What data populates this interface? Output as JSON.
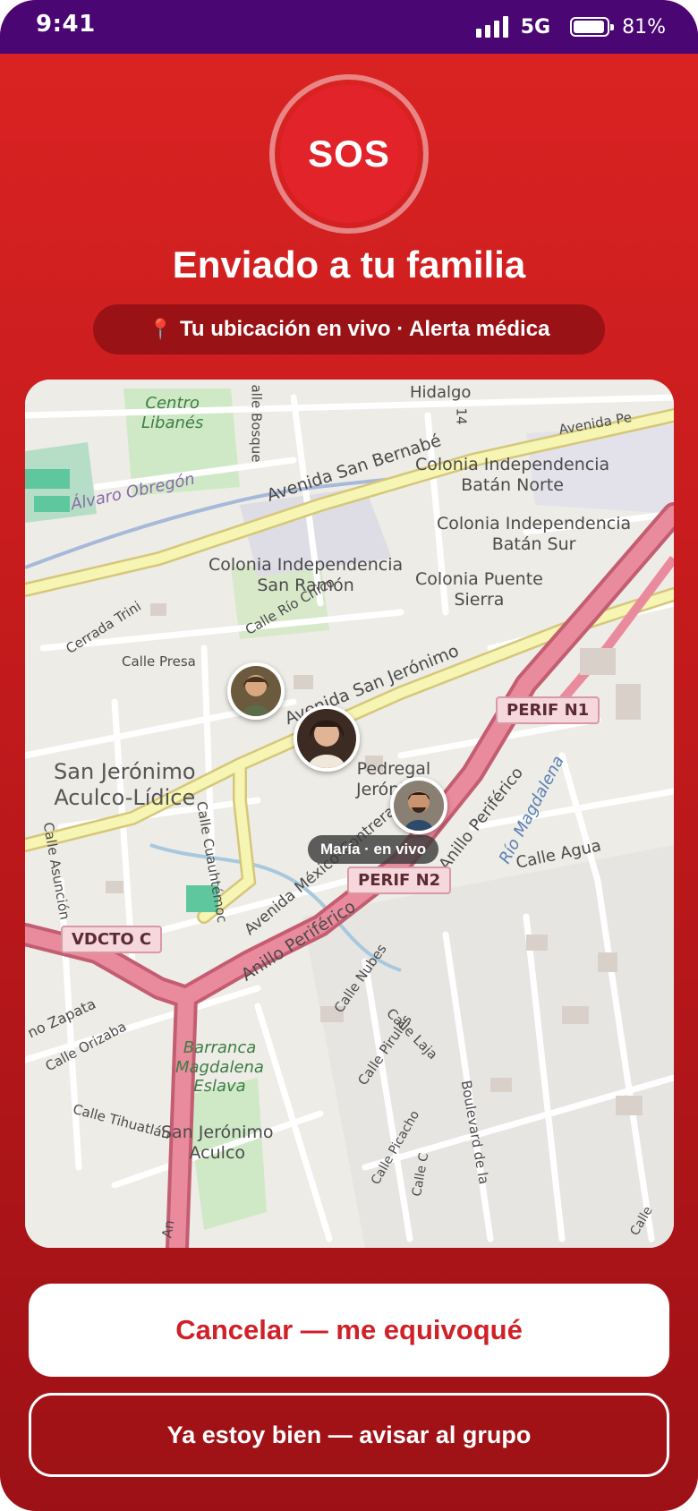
{
  "status_bar": {
    "time": "9:41",
    "network": "5G",
    "battery": "81%",
    "signal_icon": "signal-bars-icon",
    "battery_icon": "battery-icon"
  },
  "header": {
    "sos_label": "SOS",
    "title": "Enviado a tu familia",
    "pin_icon": "📍",
    "subtitle": "Tu ubicación en vivo · Alerta médica"
  },
  "map": {
    "labels": {
      "hidalgo": "Hidalgo",
      "centro_libanes": "Centro\nLibanés",
      "bosque": "alle Bosque",
      "alvaro_obregon": "Álvaro Obregón",
      "av_pe": "Avenida Pe",
      "col_batan_norte": "Colonia Independencia\nBatán Norte",
      "col_batan_sur": "Colonia Independencia\nBatán Sur",
      "col_san_ramon": "Colonia Independencia\nSan Ramón",
      "col_puente_sierra": "Colonia Puente\nSierra",
      "av_san_bernabe": "Avenida San Bernabé",
      "calle_rio_chico": "Calle Río Chico",
      "cerrada_trini": "Cerrada Trini",
      "calle_presa": "Calle Presa",
      "av_san_jeronimo": "Avenida San Jerónimo",
      "san_jeronimo_aculco_lidice": "San Jerónimo\nAculco-Lídice",
      "pedregal": "Pedregal\nJerónimo",
      "calle_cuauhtemoc": "Calle Cuauhtémoc",
      "calle_asuncion": "Calle Asunción",
      "av_mexico_contreras": "Avenida México-Contreras",
      "anillo_periferico_1": "Anillo Periférico",
      "anillo_periferico_2": "Anillo Periférico",
      "rio_magdalena": "Río Magdalena",
      "calle_agua": "Calle Agua",
      "calle_nubes": "Calle Nubes",
      "calle_laja": "Calle Laja",
      "calle_pirules": "Calle Pirules",
      "calle_picacho": "Calle Picacho",
      "calle_c": "Calle C",
      "boulevard": "Boulevard de la",
      "zapata": "no Zapata",
      "calle_orizaba": "Calle Orizaba",
      "calle_tihuatlan": "Calle Tihuatlán",
      "barranca": "Barranca\nMagdalena\nEslava",
      "san_jeronimo_aculco": "San Jerónimo\nAculco",
      "sq14": "14",
      "an": "An",
      "calle_last": "Calle"
    },
    "shields": {
      "perif_n1": "PERIF N1",
      "perif_n2": "PERIF N2",
      "vdcto_c": "VDCTO C"
    },
    "live_tag": "María · en vivo",
    "avatars": [
      "avatar-family-1",
      "avatar-maria",
      "avatar-family-2"
    ]
  },
  "actions": {
    "cancel_label": "Cancelar — me equivoqué",
    "ok_label": "Ya estoy bien — avisar al grupo"
  },
  "colors": {
    "background_top": "#dc2323",
    "background_bottom": "#9d1116",
    "status_bar": "#4a0673",
    "accent_red": "#cf2128",
    "map_base": "#eeece6",
    "primary_road": "#e58a9a",
    "secondary_road": "#f6f6b6"
  }
}
